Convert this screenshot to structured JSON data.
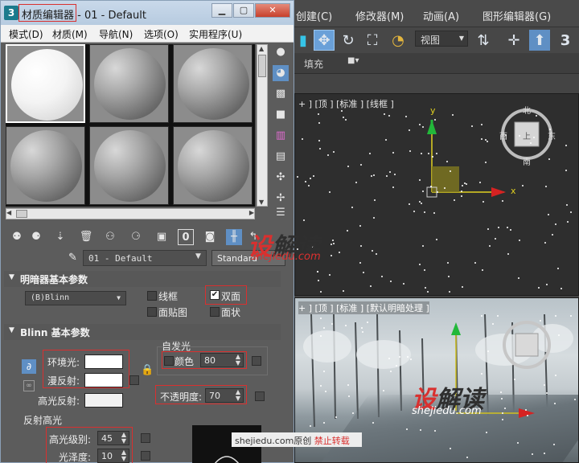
{
  "max_window": {
    "menu": [
      "创建(C)",
      "修改器(M)",
      "动画(A)",
      "图形编辑器(G)"
    ],
    "view_dropdown": "视图",
    "fill_label": "填充",
    "viewport_top_label": "+ ] [顶 ] [标准 ] [线框 ]",
    "viewport_persp_label": "+ ] [顶 ] [标准 ] [默认明暗处理 ]",
    "viewcube_top": "上",
    "viewcube_north": "北",
    "viewcube_west": "西",
    "viewcube_east": "东",
    "viewcube_south": "南",
    "axis_y": "y",
    "axis_x": "x"
  },
  "material_editor": {
    "title_highlight": "材质编辑器",
    "title_rest": "- 01 - Default",
    "menu": [
      "模式(D)",
      "材质(M)",
      "导航(N)",
      "选项(O)",
      "实用程序(U)"
    ],
    "material_name": "01 - Default",
    "material_type": "Standard",
    "shader_rollout": {
      "title": "明暗器基本参数",
      "shader": "(B)Blinn",
      "wire": "线框",
      "two_sided": "双面",
      "face_map": "面贴图",
      "faceted": "面状",
      "two_sided_checked": true
    },
    "blinn_rollout": {
      "title": "Blinn 基本参数",
      "self_illum_group": "自发光",
      "ambient": "环境光:",
      "diffuse": "漫反射:",
      "specular": "高光反射:",
      "color_label": "颜色",
      "color_value": "80",
      "opacity_label": "不透明度:",
      "opacity_value": "70",
      "spec_group": "反射高光",
      "spec_level_label": "高光级别:",
      "spec_level_value": "45",
      "gloss_label": "光泽度:",
      "gloss_value": "10"
    },
    "colors": {
      "ambient": "#ffffff",
      "diffuse": "#ffffff",
      "specular": "#ffffff"
    }
  },
  "watermark": {
    "logo_part1": "设",
    "logo_part2": "解读",
    "url": "shejiedu.com",
    "credit_url": "shejiedu.com",
    "credit_original": "原创",
    "credit_forbid": "禁止转载"
  }
}
